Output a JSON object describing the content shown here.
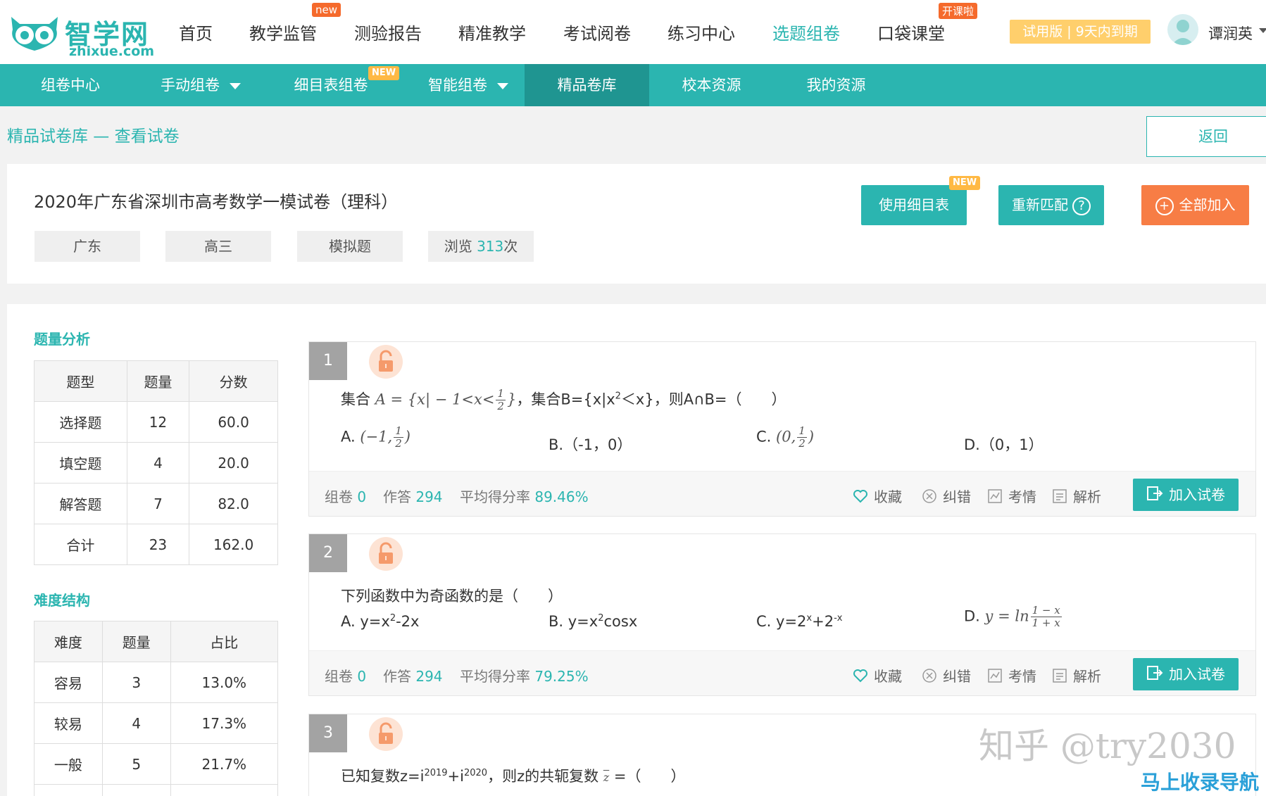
{
  "brand": {
    "name": "智学网",
    "domain": "zhixue.com"
  },
  "main_nav": [
    {
      "label": "首页"
    },
    {
      "label": "教学监管",
      "badge": "new"
    },
    {
      "label": "测验报告"
    },
    {
      "label": "精准教学"
    },
    {
      "label": "考试阅卷"
    },
    {
      "label": "练习中心"
    },
    {
      "label": "选题组卷",
      "active": true
    },
    {
      "label": "口袋课堂",
      "badge": "开课啦"
    }
  ],
  "trial_label": "试用版 | 9天内到期",
  "user": {
    "name": "谭润英"
  },
  "sub_nav": [
    {
      "label": "组卷中心"
    },
    {
      "label": "手动组卷",
      "dropdown": true
    },
    {
      "label": "细目表组卷",
      "badge": "NEW"
    },
    {
      "label": "智能组卷",
      "dropdown": true
    },
    {
      "label": "精品卷库",
      "active": true
    },
    {
      "label": "校本资源"
    },
    {
      "label": "我的资源"
    }
  ],
  "breadcrumb": "精品试卷库 — 查看试卷",
  "back_label": "返回",
  "paper": {
    "title": "2020年广东省深圳市高考数学一模试卷（理科）",
    "tags": [
      "广东",
      "高三",
      "模拟题"
    ],
    "views_prefix": "浏览 ",
    "views_count": "313",
    "views_suffix": "次",
    "btn_use_table": "使用细目表",
    "btn_use_table_badge": "NEW",
    "btn_rematch": "重新匹配",
    "btn_add_all": "全部加入"
  },
  "analysis": {
    "title": "题量分析",
    "headers": [
      "题型",
      "题量",
      "分数"
    ],
    "rows": [
      [
        "选择题",
        "12",
        "60.0"
      ],
      [
        "填空题",
        "4",
        "20.0"
      ],
      [
        "解答题",
        "7",
        "82.0"
      ],
      [
        "合计",
        "23",
        "162.0"
      ]
    ]
  },
  "difficulty": {
    "title": "难度结构",
    "headers": [
      "难度",
      "题量",
      "占比"
    ],
    "rows": [
      [
        "容易",
        "3",
        "13.0%"
      ],
      [
        "较易",
        "4",
        "17.3%"
      ],
      [
        "一般",
        "5",
        "21.7%"
      ]
    ]
  },
  "questions": [
    {
      "num": "1",
      "stem_prefix": "集合",
      "stem_math": "A = {x| − 1<x<",
      "stem_math_frac": [
        "1",
        "2"
      ],
      "stem_math_end": "}",
      "stem_suffix": "，集合B={x|x",
      "stem_sup": "2",
      "stem_end": "＜x}，则A∩B=（　　）",
      "options": {
        "a_label": "A.",
        "a_math": "(−1,",
        "a_frac": [
          "1",
          "2"
        ],
        "a_end": ")",
        "b": "B.（-1，0）",
        "c_label": "C.",
        "c_math": "(0,",
        "c_frac": [
          "1",
          "2"
        ],
        "c_end": ")",
        "d": "D.（0，1）"
      },
      "stats": {
        "zujuan_label": "组卷",
        "zujuan": "0",
        "zuoda_label": "作答",
        "zuoda": "294",
        "rate_label": "平均得分率",
        "rate": "89.46%"
      }
    },
    {
      "num": "2",
      "stem": "下列函数中为奇函数的是（　　）",
      "options": {
        "a_pre": "A. y=x",
        "a_sup": "2",
        "a_post": "-2x",
        "b_pre": "B. y=x",
        "b_sup": "2",
        "b_post": "cosx",
        "c_pre": "C. y=2",
        "c_sup1": "x",
        "c_mid": "+2",
        "c_sup2": "-x",
        "d_label": "D.",
        "d_math": "y = ln",
        "d_frac": [
          "1 − x",
          "1 + x"
        ]
      },
      "stats": {
        "zujuan_label": "组卷",
        "zujuan": "0",
        "zuoda_label": "作答",
        "zuoda": "294",
        "rate_label": "平均得分率",
        "rate": "79.25%"
      }
    },
    {
      "num": "3",
      "stem_pre": "已知复数z=i",
      "stem_sup1": "2019",
      "stem_mid": "+i",
      "stem_sup2": "2020",
      "stem_post": "，则z的共轭复数",
      "stem_z": "z",
      "stem_end": "=（　　）"
    }
  ],
  "actions": {
    "fav": "收藏",
    "correct": "纠错",
    "exam": "考情",
    "explain": "解析",
    "add": "加入试卷"
  },
  "watermark": "知乎 @try2030",
  "watermark2": "马上收录导航"
}
